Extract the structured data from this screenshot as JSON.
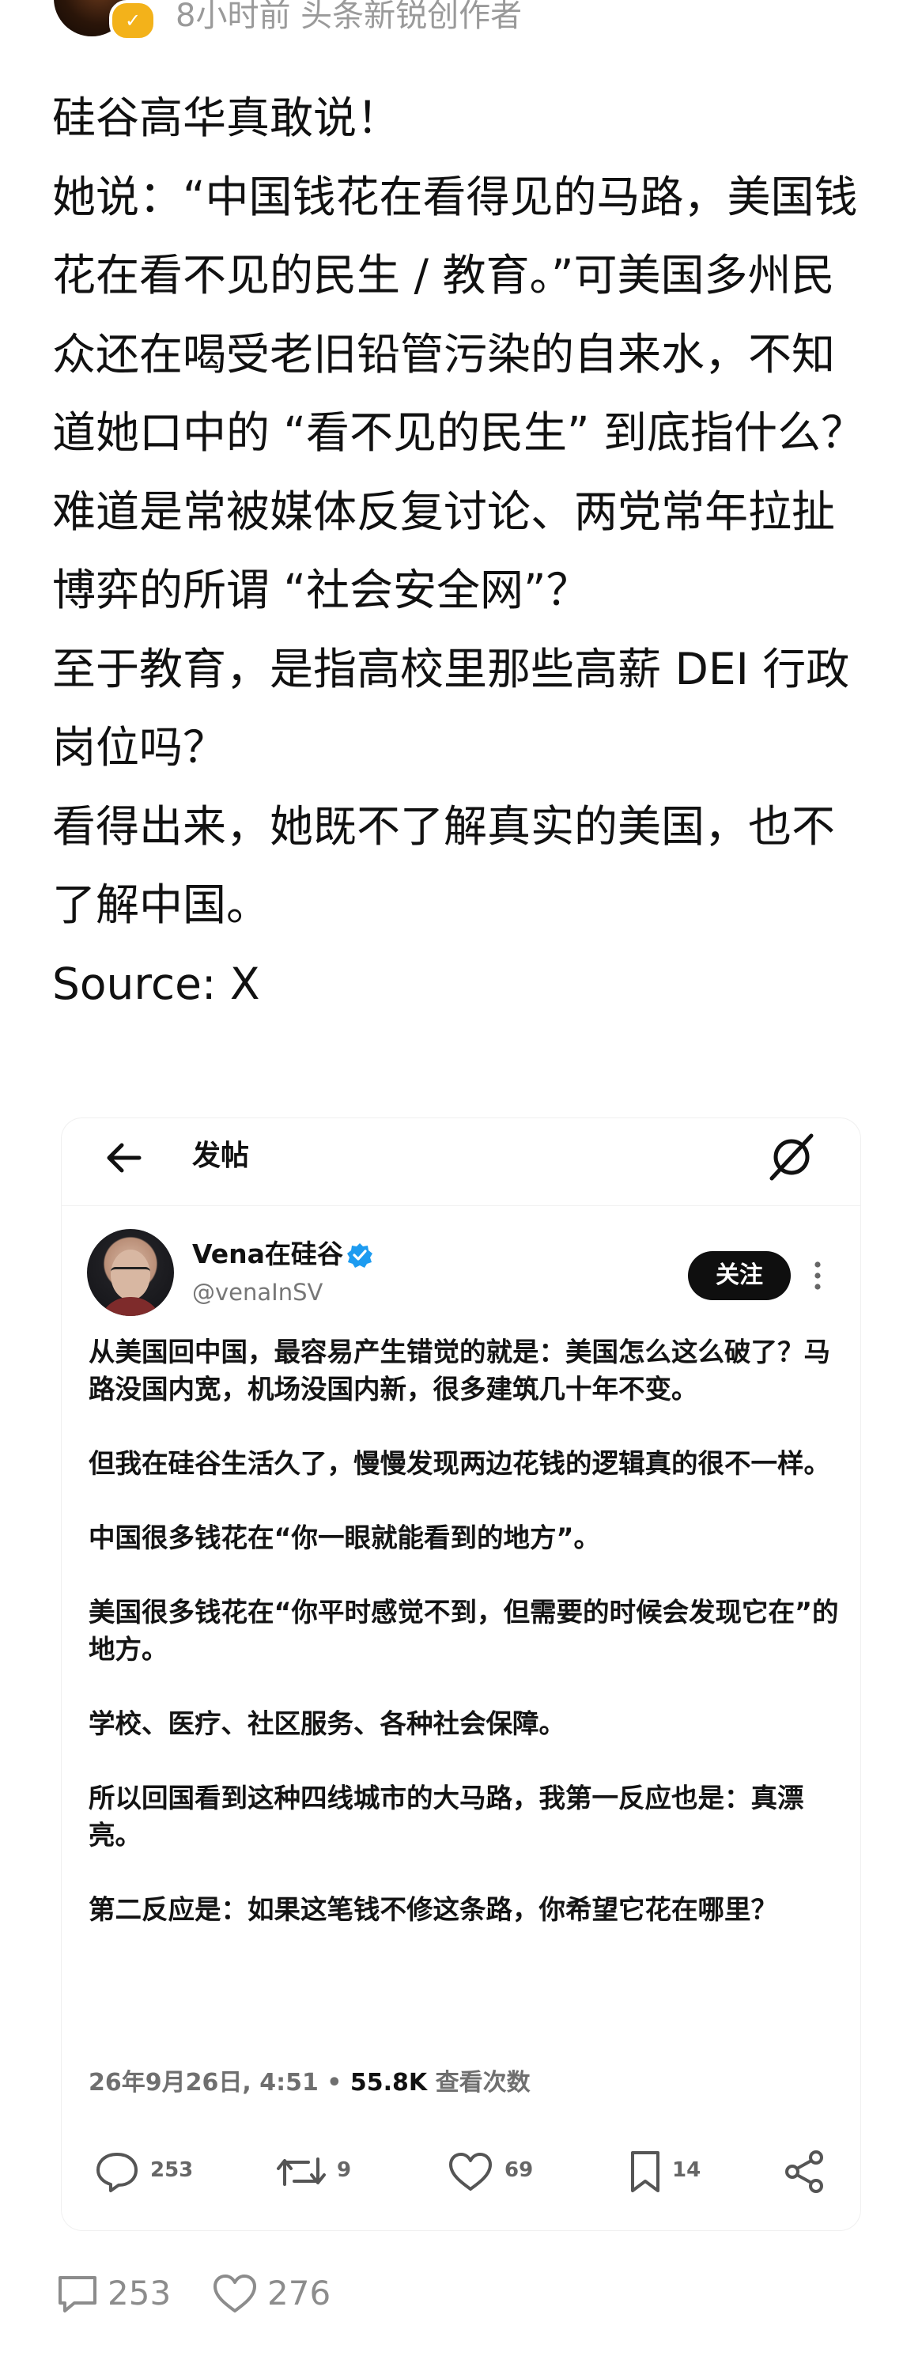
{
  "post": {
    "meta": "8小时前 头条新锐创作者",
    "badge": "",
    "paragraphs": [
      "硅谷高华真敢说！",
      "她说：“中国钱花在看得见的马路，美国钱花在看不见的民生 / 教育。”可美国多州民众还在喝受老旧铅管污染的自来水，不知道她口中的 “看不见的民生” 到底指什么？难道是常被媒体反复讨论、两党常年拉扯博弈的所谓 “社会安全网”？",
      "至于教育，是指高校里那些高薪 DEI 行政岗位吗？",
      "看得出来，她既不了解真实的美国，也不了解中国。",
      "Source: X"
    ]
  },
  "embed": {
    "header_title": "发帖",
    "author_name": "Vena在硅谷",
    "author_handle": "@venaInSV",
    "follow_label": "关注",
    "tweet_paragraphs": [
      "从美国回中国，最容易产生错觉的就是：美国怎么这么破了？马路没国内宽，机场没国内新，很多建筑几十年不变。",
      "但我在硅谷生活久了，慢慢发现两边花钱的逻辑真的很不一样。",
      "中国很多钱花在“你一眼就能看到的地方”。",
      "美国很多钱花在“你平时感觉不到，但需要的时候会发现它在”的地方。",
      "学校、医疗、社区服务、各种社会保障。",
      "所以回国看到这种四线城市的大马路，我第一反应也是：真漂亮。",
      "第二反应是：如果这笔钱不修这条路，你希望它花在哪里？"
    ],
    "timestamp": "26年9月26日, 4:51 • ",
    "views_count": "55.8K",
    "views_label": " 查看次数",
    "actions": {
      "replies": "253",
      "reposts": "9",
      "likes": "69",
      "bookmarks": "14"
    }
  },
  "footer": {
    "comments": "253",
    "likes": "276"
  },
  "colors": {
    "meta_gray": "#9a9a9a",
    "verified_blue": "#1d9bf0",
    "badge_gold": "#f3b21a",
    "follow_bg": "#0f0f0f"
  }
}
